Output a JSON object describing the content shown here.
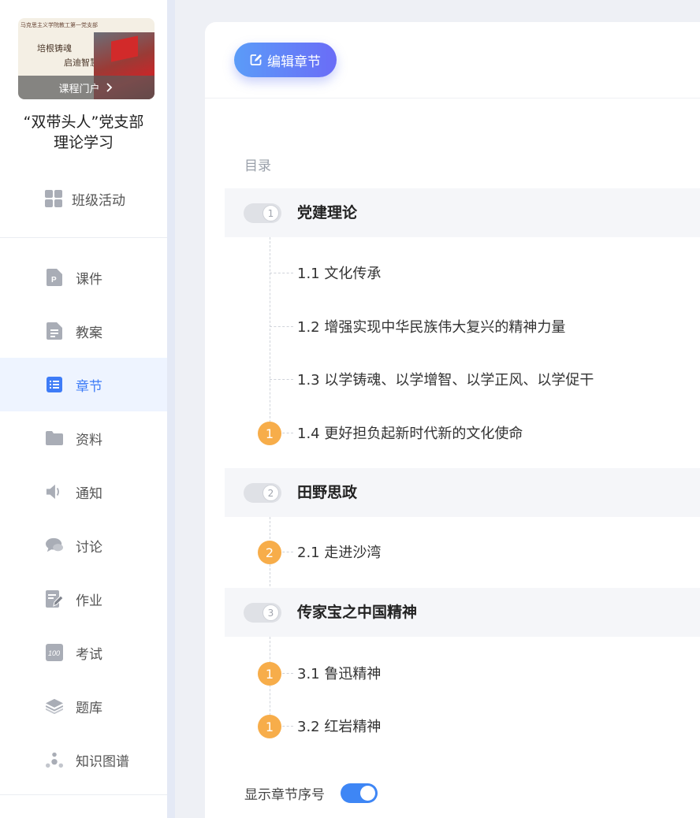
{
  "sidebar": {
    "banner": {
      "top_text": "马克思主义学院教工第一党支部",
      "slogan_line1": "培根铸魂",
      "slogan_line2": "启迪智慧",
      "portal_label": "课程门户"
    },
    "course_title": "“双带头人”党支部理论学习",
    "class_activity_label": "班级活动",
    "items": [
      {
        "label": "课件",
        "icon": "ppt-file-icon"
      },
      {
        "label": "教案",
        "icon": "lesson-plan-file-icon"
      },
      {
        "label": "章节",
        "icon": "list-icon",
        "active": true
      },
      {
        "label": "资料",
        "icon": "folder-icon"
      },
      {
        "label": "通知",
        "icon": "speaker-icon"
      },
      {
        "label": "讨论",
        "icon": "chat-bubble-icon"
      },
      {
        "label": "作业",
        "icon": "edit-document-icon"
      },
      {
        "label": "考试",
        "icon": "exam-score-icon"
      },
      {
        "label": "题库",
        "icon": "layers-icon"
      },
      {
        "label": "知识图谱",
        "icon": "knowledge-graph-icon"
      }
    ]
  },
  "main": {
    "edit_button_label": "编辑章节",
    "toc_title": "目录",
    "chapters": [
      {
        "number": "1",
        "title": "党建理论",
        "sections": [
          {
            "label": "1.1 文化传承",
            "badge": ""
          },
          {
            "label": "1.2 增强实现中华民族伟大复兴的精神力量",
            "badge": ""
          },
          {
            "label": "1.3 以学铸魂、以学增智、以学正风、以学促干",
            "badge": ""
          },
          {
            "label": "1.4 更好担负起新时代新的文化使命",
            "badge": "1"
          }
        ]
      },
      {
        "number": "2",
        "title": "田野思政",
        "sections": [
          {
            "label": "2.1 走进沙湾",
            "badge": "2"
          }
        ]
      },
      {
        "number": "3",
        "title": "传家宝之中国精神",
        "sections": [
          {
            "label": "3.1 鲁迅精神",
            "badge": "1"
          },
          {
            "label": "3.2 红岩精神",
            "badge": "1"
          }
        ]
      }
    ],
    "show_number_label": "显示章节序号",
    "show_number_enabled": true
  },
  "colors": {
    "accent": "#3e7cf7",
    "badge": "#f7ad4a",
    "switch_on": "#3e86f5"
  }
}
